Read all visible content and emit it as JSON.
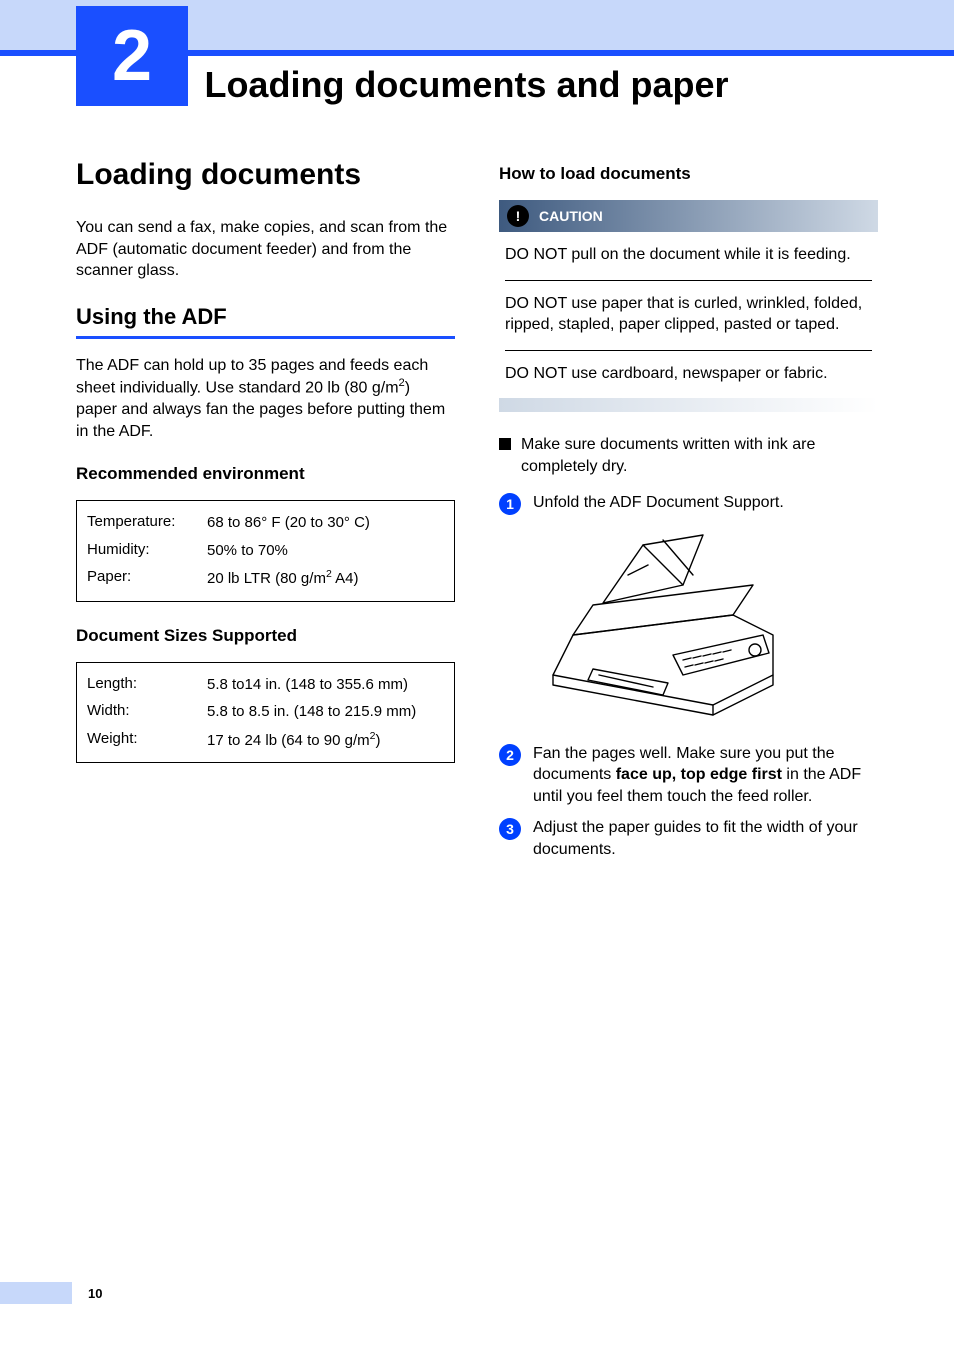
{
  "chapter": {
    "number": "2",
    "title": "Loading documents and paper"
  },
  "left": {
    "h1": "Loading documents",
    "intro": "You can send a fax, make copies, and scan from the ADF (automatic document feeder) and from the scanner glass.",
    "h2": "Using the ADF",
    "adf_para_before_sup": "The ADF can hold up to 35 pages and feeds each sheet individually. Use standard 20 lb (80 g/m",
    "adf_para_sup": "2",
    "adf_para_after_sup": ") paper and always fan the pages before putting them in the ADF.",
    "env_h3": "Recommended environment",
    "env_rows": {
      "temperature": {
        "label": "Temperature:",
        "value": "68 to 86° F (20 to 30° C)"
      },
      "humidity": {
        "label": "Humidity:",
        "value": "50% to 70%"
      },
      "paper": {
        "label": "Paper:",
        "value_before_sup": "20 lb LTR (80 g/m",
        "value_sup": "2",
        "value_after_sup": "  A4)"
      }
    },
    "sizes_h3": "Document Sizes Supported",
    "sizes_rows": {
      "length": {
        "label": "Length:",
        "value": "5.8 to14 in. (148 to 355.6 mm)"
      },
      "width": {
        "label": "Width:",
        "value": "5.8 to 8.5 in. (148 to 215.9 mm)"
      },
      "weight": {
        "label": "Weight:",
        "value_before_sup": "17 to 24 lb (64 to 90 g/m",
        "value_sup": "2",
        "value_after_sup": ")"
      }
    }
  },
  "right": {
    "h3": "How to load documents",
    "caution_label": "CAUTION",
    "caution_icon": "!",
    "caution_items": {
      "a": "DO NOT pull on the document while it is feeding.",
      "b": "DO NOT use paper that is curled, wrinkled, folded, ripped, stapled, paper clipped, pasted or taped.",
      "c": "DO NOT use cardboard, newspaper or fabric."
    },
    "bullet": "Make sure documents written with ink are completely dry.",
    "steps": {
      "s1": {
        "num": "1",
        "text": "Unfold the ADF Document Support."
      },
      "s2": {
        "num": "2",
        "text_before_bold": "Fan the pages well. Make sure you put the documents ",
        "text_bold": "face up, top edge first",
        "text_after_bold": " in the ADF until you feel them touch the feed roller."
      },
      "s3": {
        "num": "3",
        "text": "Adjust the paper guides to fit the width of your documents."
      }
    }
  },
  "footer": {
    "page_num": "10"
  }
}
